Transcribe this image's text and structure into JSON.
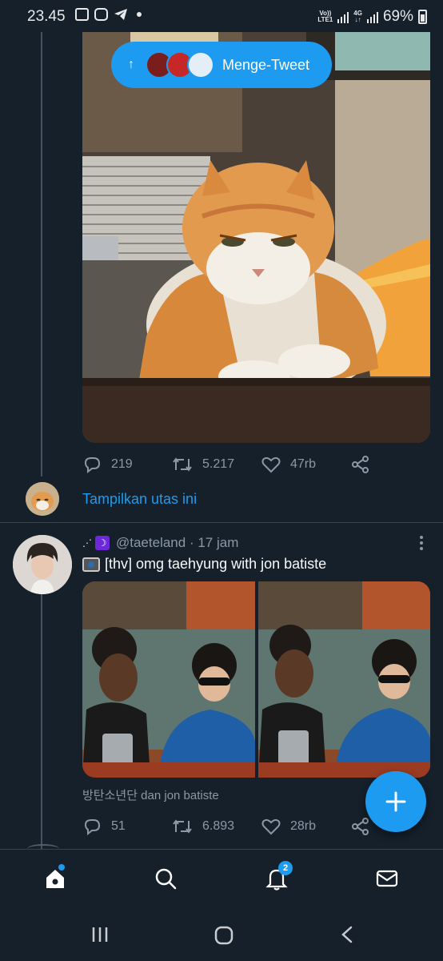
{
  "status_bar": {
    "time": "23.45",
    "network_top": "Vo))",
    "network_bottom": "LTE1",
    "data_top": "4G",
    "data_bottom": "↓↑",
    "battery": "69%"
  },
  "new_tweets_pill": {
    "label": "Menge-Tweet",
    "arrow": "↑",
    "avatar_colors": [
      "#7a1d1d",
      "#c62828",
      "#e3eef7"
    ]
  },
  "tweet1": {
    "image_alt": "grumpy orange and white cat with crossed paws",
    "actions": {
      "replies": "219",
      "retweets": "5.217",
      "likes": "47rb"
    }
  },
  "show_thread": {
    "label": "Tampilkan utas ini"
  },
  "tweet2": {
    "sparkle": "⋰",
    "moon": "☽",
    "handle": "@taeteland",
    "separator": " · ",
    "time": "17 jam",
    "text": "[thv] omg taehyung with jon batiste",
    "tagged": "방탄소년단 dan jon batiste",
    "actions": {
      "replies": "51",
      "retweets": "6.893",
      "likes": "28rb"
    }
  },
  "bottom_nav": {
    "notifications_count": "2"
  },
  "colors": {
    "background": "#15202b",
    "accent": "#1d9bf0",
    "muted_text": "#8b98a5",
    "divider": "#38444d"
  }
}
